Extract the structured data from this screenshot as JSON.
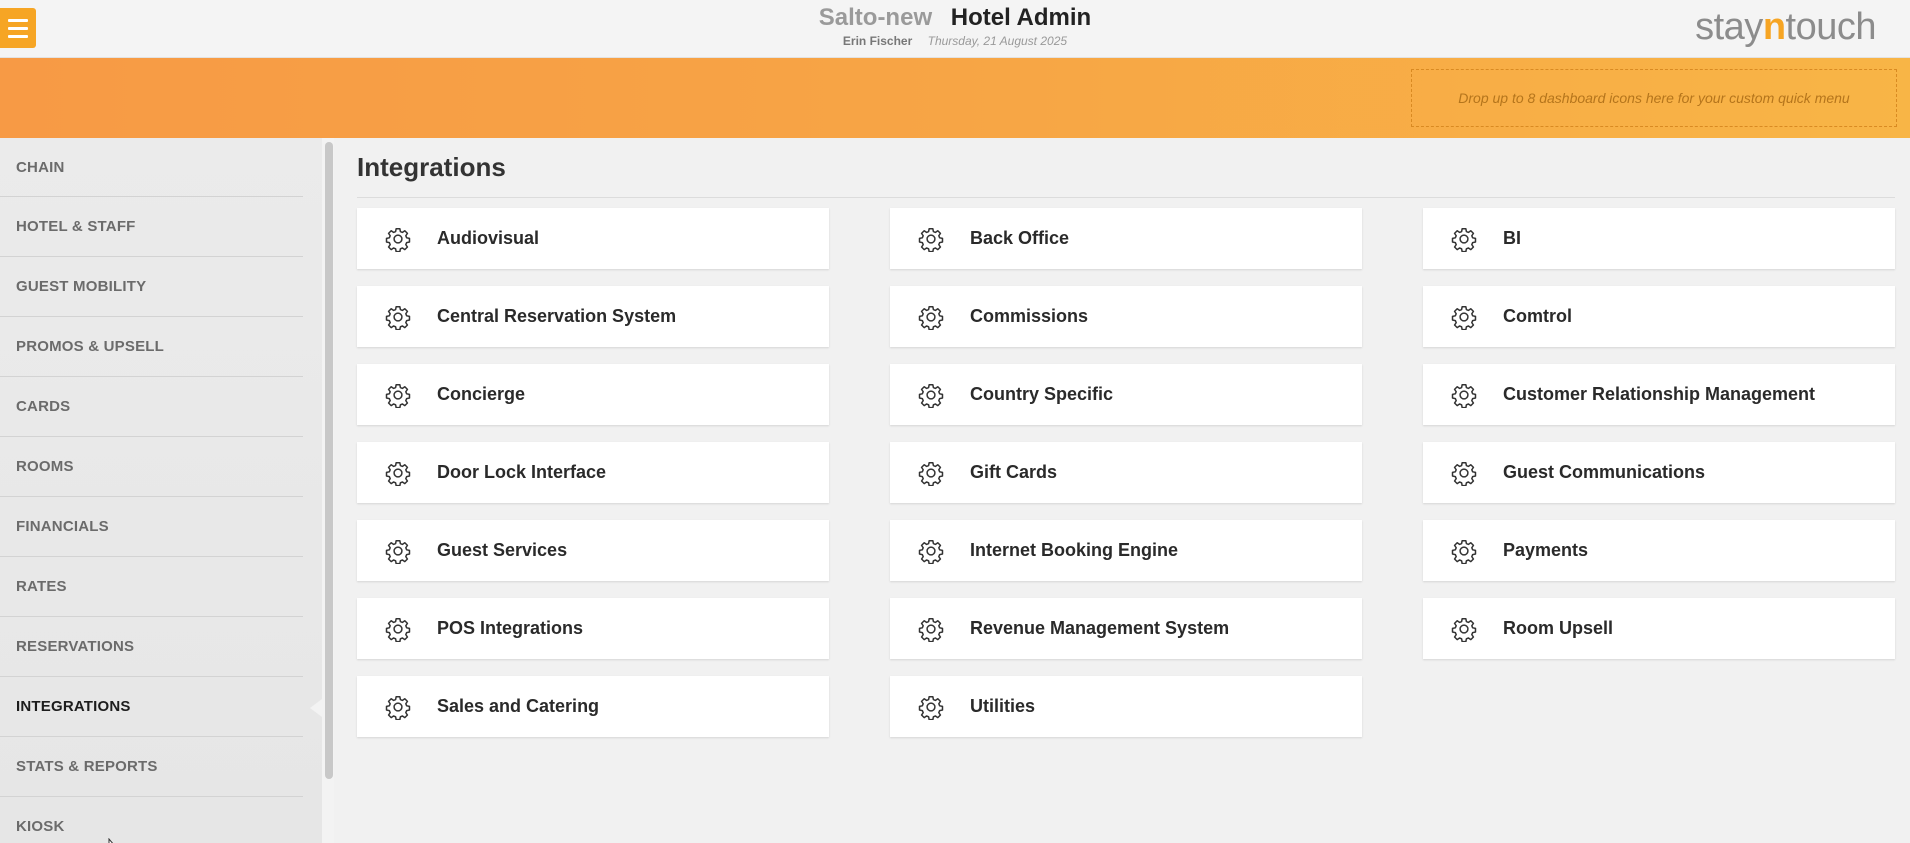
{
  "header": {
    "hotel_name": "Salto-new",
    "app_title": "Hotel Admin",
    "user_name": "Erin Fischer",
    "date": "Thursday, 21 August 2025",
    "brand_prefix": "stay",
    "brand_accent": "n",
    "brand_suffix": "touch",
    "menu_icon": "hamburger-menu-icon"
  },
  "quick_menu": {
    "dropzone_text": "Drop up to 8 dashboard icons here for your custom quick menu"
  },
  "sidebar": {
    "items": [
      {
        "label": "CHAIN"
      },
      {
        "label": "HOTEL & STAFF"
      },
      {
        "label": "GUEST MOBILITY"
      },
      {
        "label": "PROMOS & UPSELL"
      },
      {
        "label": "CARDS"
      },
      {
        "label": "ROOMS"
      },
      {
        "label": "FINANCIALS"
      },
      {
        "label": "RATES"
      },
      {
        "label": "RESERVATIONS"
      },
      {
        "label": "INTEGRATIONS",
        "active": true
      },
      {
        "label": "STATS & REPORTS"
      },
      {
        "label": "KIOSK"
      }
    ]
  },
  "main": {
    "title": "Integrations",
    "tile_icon": "gear-icon",
    "tiles": [
      {
        "label": "Audiovisual"
      },
      {
        "label": "Back Office"
      },
      {
        "label": "BI"
      },
      {
        "label": "Central Reservation System"
      },
      {
        "label": "Commissions"
      },
      {
        "label": "Comtrol"
      },
      {
        "label": "Concierge"
      },
      {
        "label": "Country Specific"
      },
      {
        "label": "Customer Relationship Management"
      },
      {
        "label": "Door Lock Interface"
      },
      {
        "label": "Gift Cards"
      },
      {
        "label": "Guest Communications"
      },
      {
        "label": "Guest Services"
      },
      {
        "label": "Internet Booking Engine"
      },
      {
        "label": "Payments"
      },
      {
        "label": "POS Integrations"
      },
      {
        "label": "Revenue Management System"
      },
      {
        "label": "Room Upsell"
      },
      {
        "label": "Sales and Catering"
      },
      {
        "label": "Utilities"
      }
    ]
  },
  "colors": {
    "accent": "#f6a524",
    "band_start": "#f79a45",
    "band_end": "#f8b546"
  }
}
